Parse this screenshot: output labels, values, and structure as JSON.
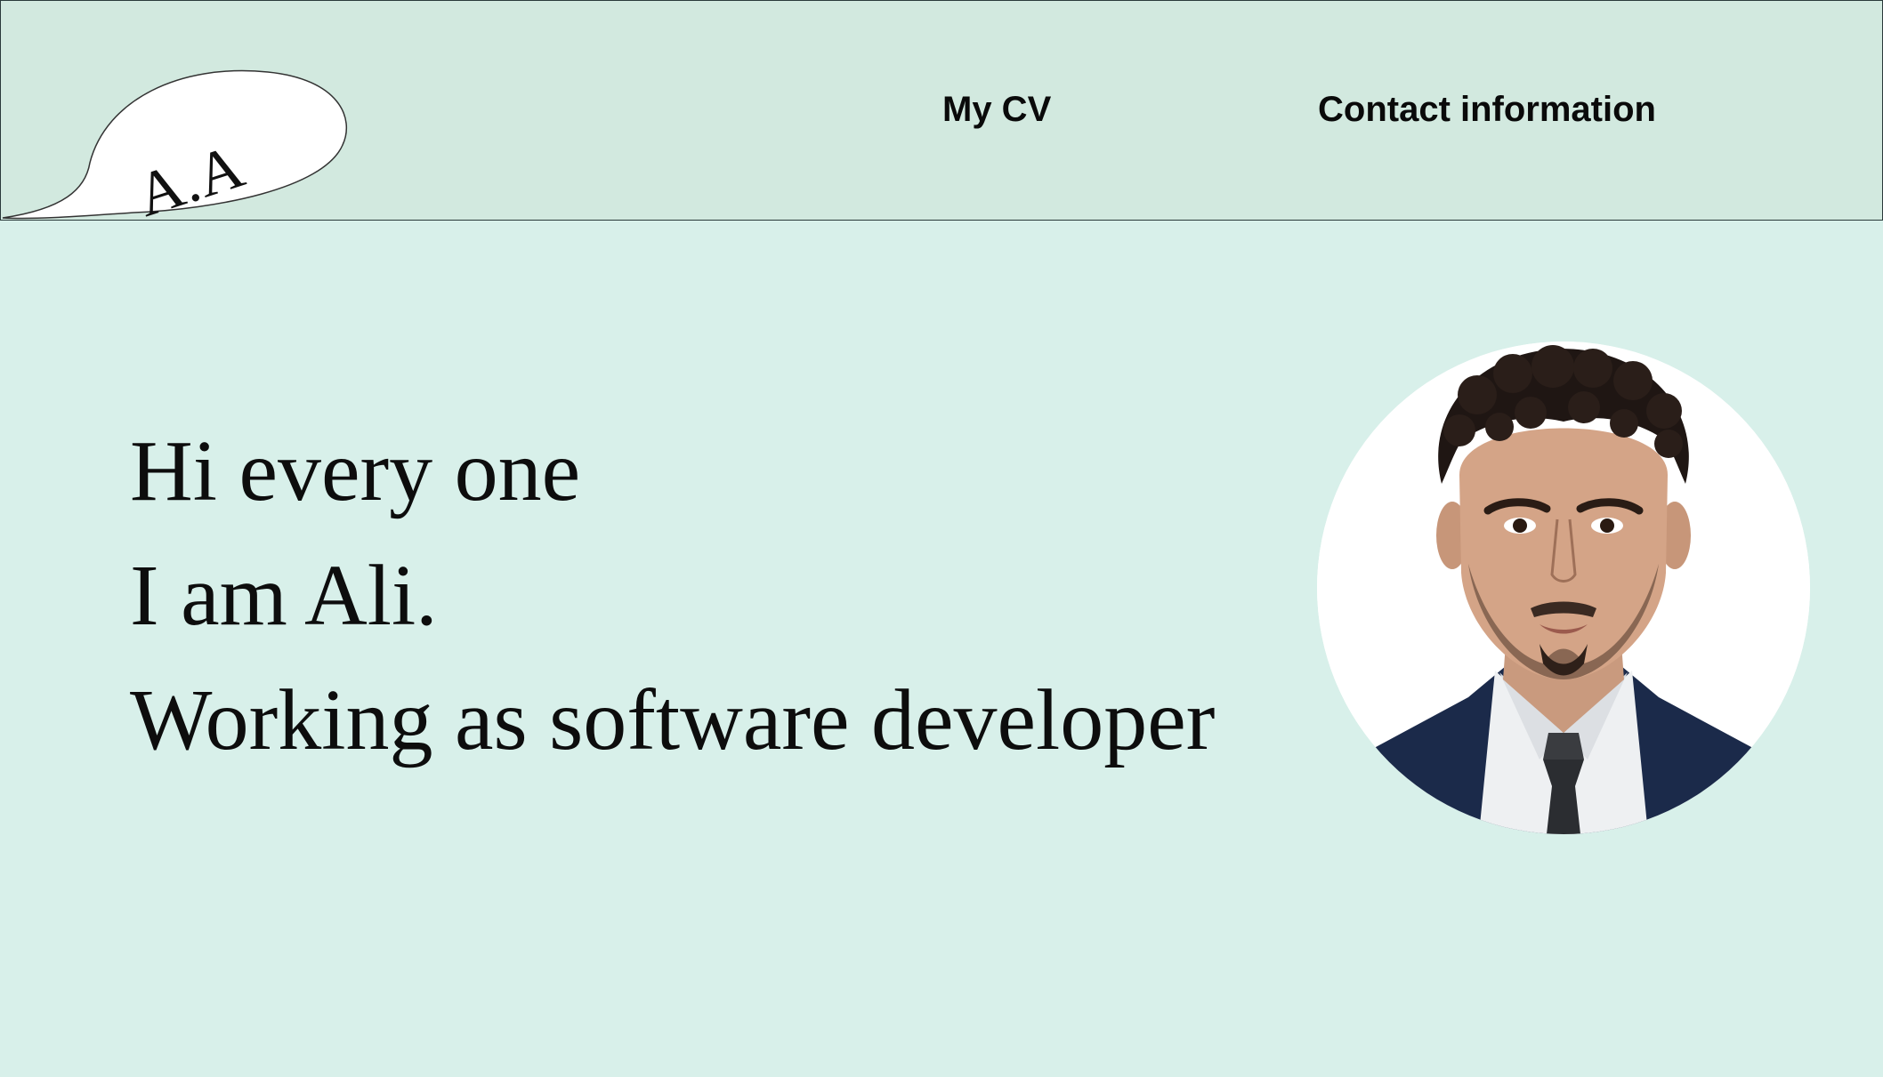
{
  "header": {
    "logo_text": "A.A",
    "nav": {
      "cv_label": "My CV",
      "contact_label": "Contact information"
    }
  },
  "hero": {
    "line1": "Hi every one",
    "line2": "I am Ali.",
    "line3": "Working as software developer"
  },
  "colors": {
    "page_background": "#d8f0ea",
    "header_background": "#d2e9df",
    "text": "#0d0d0d"
  },
  "icons": {
    "logo": "speech-bubble-logo",
    "avatar": "profile-photo"
  }
}
